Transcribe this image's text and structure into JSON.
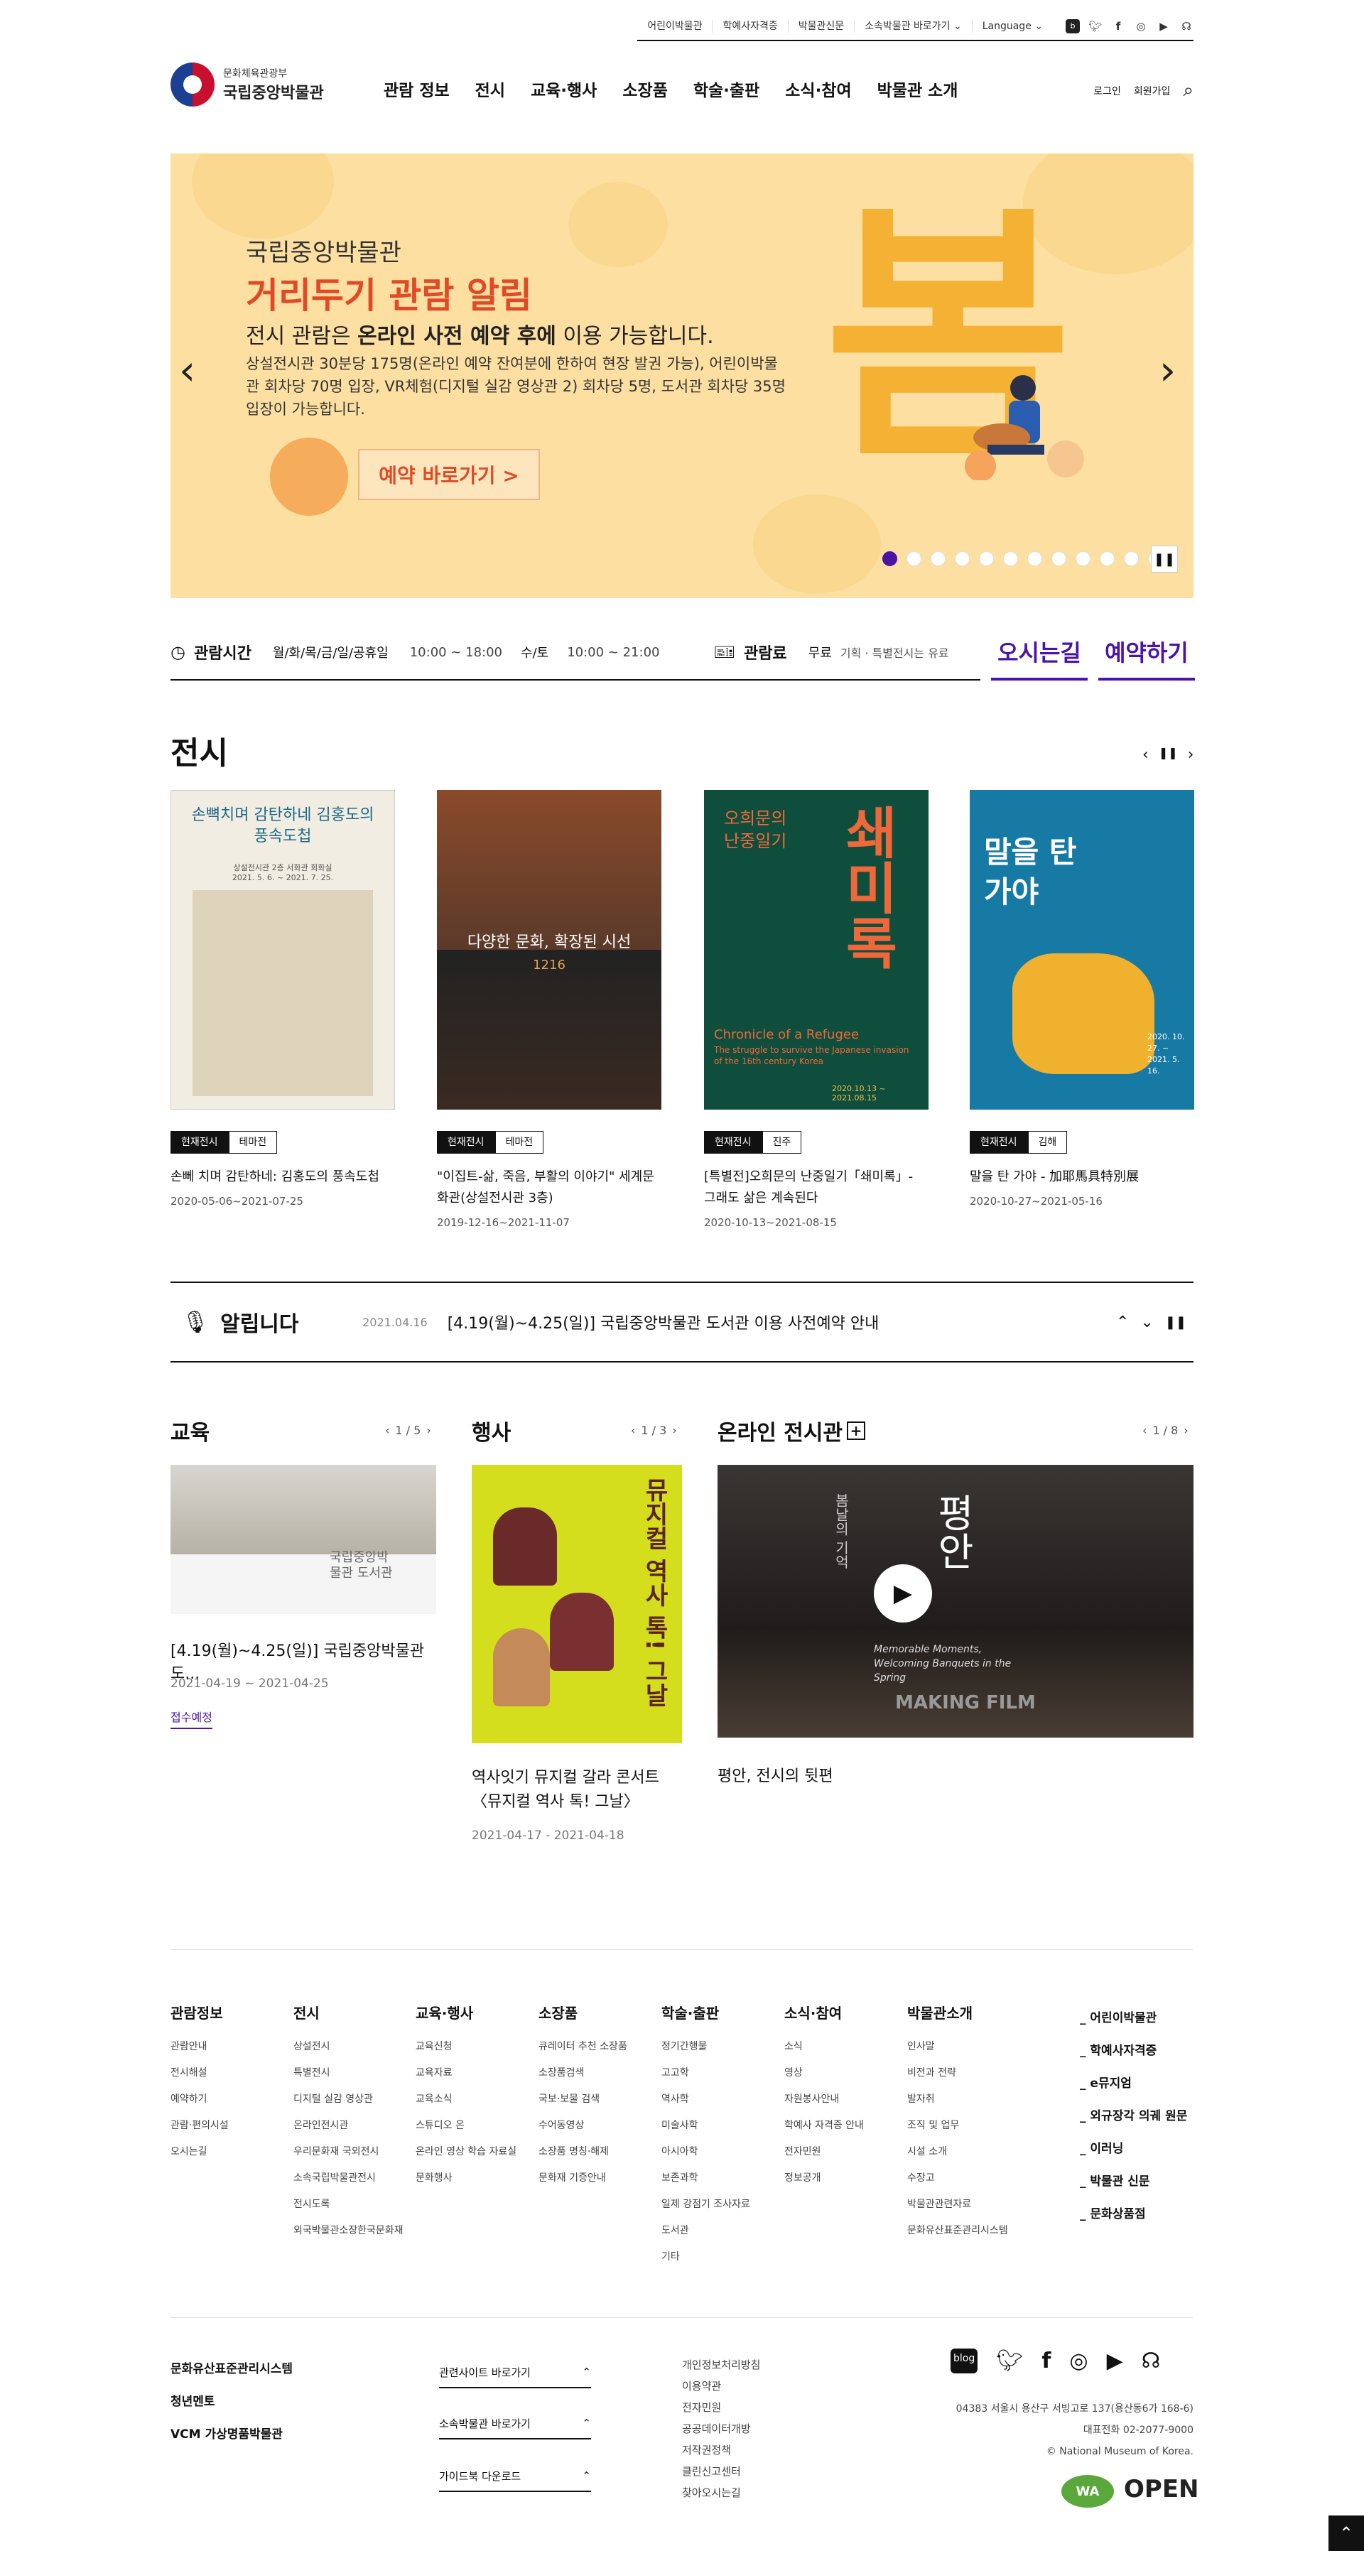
{
  "util": {
    "links": [
      "어린이박물관",
      "학예사자격증",
      "박물관신문",
      "소속박물관 바로가기",
      "Language"
    ]
  },
  "logo": {
    "line1": "문화체육관광부",
    "line2": "국립중앙박물관"
  },
  "gnb": [
    "관람 정보",
    "전시",
    "교육·행사",
    "소장품",
    "학술·출판",
    "소식·참여",
    "박물관 소개"
  ],
  "header_links": {
    "login": "로그인",
    "join": "회원가입"
  },
  "banner": {
    "small": "국립중앙박물관",
    "big": "거리두기 관람 알림",
    "mid_a": "전시 관람은 ",
    "mid_b": "온라인 사전 예약 후에",
    "mid_c": " 이용 가능합니다.",
    "para": "상설전시관 30분당 175명(온라인 예약 잔여분에 한하여 현장 발권 가능), 어린이박물관 회차당 70명 입장, VR체험(디지털 실감 영상관 2) 회차당 5명, 도서관 회차당 35명 입장이 가능합니다.",
    "button": "예약 바로가기 >",
    "deco": "봄",
    "dots": 12
  },
  "info": {
    "hours_label": "관람시간",
    "hours1_days": "월/화/목/금/일/공휴일",
    "hours1_time": "10:00 ~ 18:00",
    "hours2_days": "수/토",
    "hours2_time": "10:00 ~ 21:00",
    "fee_label": "관람료",
    "fee_val": "무료",
    "fee_note": "기획 · 특별전시는 유료",
    "directions": "오시는길",
    "reserve": "예약하기"
  },
  "exhibit": {
    "title": "전시",
    "cards": [
      {
        "tag1": "현재전시",
        "tag2": "테마전",
        "title": "손뻬 치며 감탄하네: 김홍도의 풍속도첩",
        "date": "2020-05-06~2021-07-25",
        "poster_title": "손뼉치며 감탄하네 김홍도의 풍속도첩",
        "poster_sub": "상설전시관 2층 서화관 회화실",
        "poster_date": "2021. 5. 6. ~ 2021. 7. 25."
      },
      {
        "tag1": "현재전시",
        "tag2": "테마전",
        "title": "\"이집트-삶, 죽음, 부활의 이야기\" 세계문화관(상설전시관 3층)",
        "date": "2019-12-16~2021-11-07",
        "poster_title": "다양한 문화, 확장된 시선",
        "poster_sub": "1216"
      },
      {
        "tag1": "현재전시",
        "tag2": "진주",
        "title": "[특별전]오희문의 난중일기「쇄미록」- 그래도 삶은 계속된다",
        "date": "2020-10-13~2021-08-15",
        "poster_title": "오희문의 난중일기",
        "poster_big": "쇄미록",
        "poster_en": "Chronicle of a Refugee",
        "poster_sub": "The struggle to survive the Japanese invasion of the 16th century Korea",
        "poster_date": "2020.10.13 ~ 2021.08.15"
      },
      {
        "tag1": "현재전시",
        "tag2": "김해",
        "title": "말을 탄 가야 - 加耶馬具特別展",
        "date": "2020-10-27~2021-05-16",
        "poster_title": "말을 탄 가야",
        "poster_date": "2020. 10. 27. ~ 2021. 5. 16."
      }
    ]
  },
  "notice": {
    "label": "알립니다",
    "date": "2021.04.16",
    "text": "[4.19(월)~4.25(일)] 국립중앙박물관 도서관 이용 사전예약 안내"
  },
  "edu": {
    "title": "교육",
    "pager": "1 / 5",
    "item_title": "[4.19(월)~4.25(일)] 국립중앙박물관 도...",
    "date": "2021-04-19 ~ 2021-04-25",
    "status": "접수예정",
    "thumb_text": "국립중앙박물관 도서관"
  },
  "event": {
    "title": "행사",
    "pager": "1 / 3",
    "item_title": "역사잇기 뮤지컬 갈라 콘서트〈뮤지컬 역사 톡! 그날〉",
    "date": "2021-04-17 - 2021-04-18",
    "poster_text": "뮤지컬 역사 톡! 그날"
  },
  "online": {
    "title": "온라인 전시관",
    "pager": "1 / 8",
    "item_title": "평안, 전시의 뒷편",
    "video_a": "평안",
    "video_b": "평",
    "video_c": "안",
    "video_en": "Memorable Moments, Welcoming Banquets in the Spring",
    "video_film": "MAKING FILM",
    "video_left": "봄날의 기억"
  },
  "footer_cols": [
    {
      "h": "관람정보",
      "items": [
        "관람안내",
        "전시해설",
        "예약하기",
        "관람·편의시설",
        "오시는길"
      ]
    },
    {
      "h": "전시",
      "items": [
        "상설전시",
        "특별전시",
        "디지털 실감 영상관",
        "온라인전시관",
        "우리문화재 국외전시",
        "소속국립박물관전시",
        "전시도록",
        "외국박물관소장한국문화재"
      ]
    },
    {
      "h": "교육·행사",
      "items": [
        "교육신청",
        "교육자료",
        "교육소식",
        "스튜디오 온",
        "온라인 영상 학습 자료실",
        "문화행사"
      ]
    },
    {
      "h": "소장품",
      "items": [
        "큐레이터 추천 소장품",
        "소장품검색",
        "국보·보물 검색",
        "수어동영상",
        "소장품 명칭·해제",
        "문화재 기증안내"
      ]
    },
    {
      "h": "학술·출판",
      "items": [
        "정기간행물",
        "고고학",
        "역사학",
        "미술사학",
        "아시아학",
        "보존과학",
        "일제 강점기 조사자료",
        "도서관",
        "기타"
      ]
    },
    {
      "h": "소식·참여",
      "items": [
        "소식",
        "영상",
        "자원봉사안내",
        "학예사 자격증 안내",
        "전자민원",
        "정보공개"
      ]
    },
    {
      "h": "박물관소개",
      "items": [
        "인사말",
        "비전과 전략",
        "발자취",
        "조직 및 업무",
        "시설 소개",
        "수장고",
        "박물관관련자료",
        "문화유산표준관리시스템"
      ]
    }
  ],
  "footer_extra": [
    "_ 어린이박물관",
    "_ 학예사자격증",
    "_ e뮤지엄",
    "_ 외규장각 의궤 원문",
    "_ 이러닝",
    "_ 박물관 신문",
    "_ 문화상품점"
  ],
  "footer_left": [
    "문화유산표준관리시스템",
    "청년멘토",
    "VCM 가상명품박물관"
  ],
  "footer_selects": [
    "관련사이트 바로가기",
    "소속박물관 바로가기",
    "가이드북 다운로드"
  ],
  "footer_links": [
    "개인정보처리방침",
    "이용약관",
    "전자민원",
    "공공데이터개방",
    "저작권정책",
    "클린신고센터",
    "찾아오시는길"
  ],
  "footer_addr": {
    "addr": "04383 서울시 용산구 서빙고로 137(용산동6가 168-6)",
    "tel": "대표전화 02-2077-9000",
    "copy": "© National Museum of Korea."
  },
  "badges": {
    "wa": "WA",
    "open": "OPEN"
  }
}
